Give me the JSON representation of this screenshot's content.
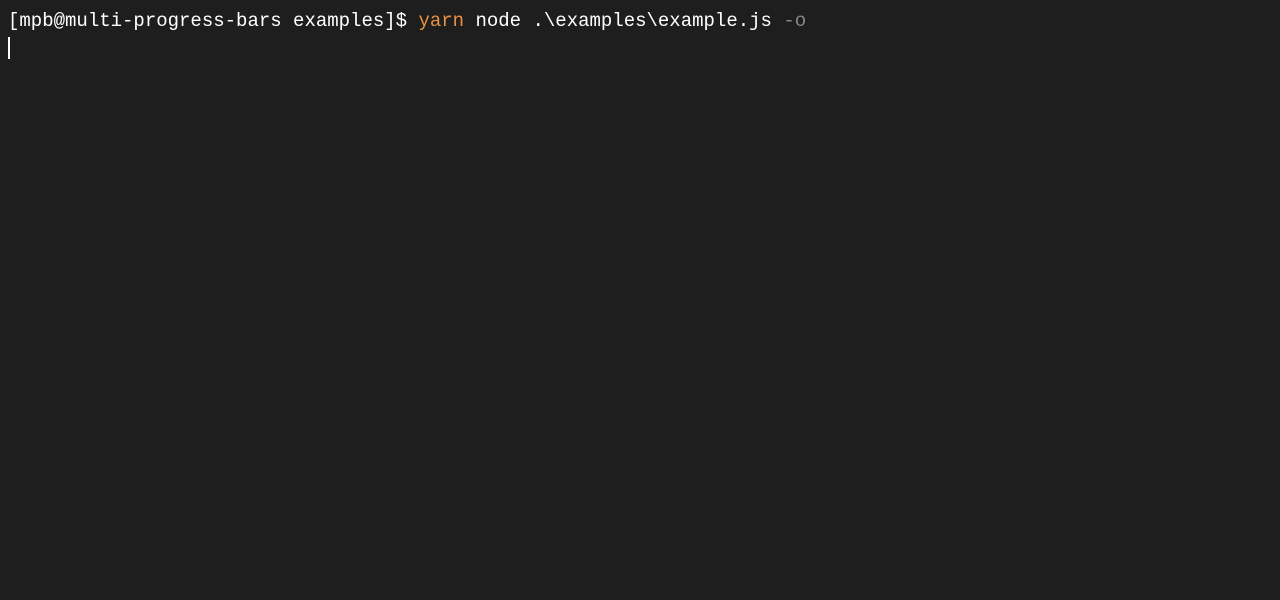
{
  "terminal": {
    "prompt": "[mpb@multi-progress-bars examples]$ ",
    "command_parts": {
      "yarn": "yarn",
      "node_path": " node .\\examples\\example.js ",
      "flag": "-o"
    }
  }
}
